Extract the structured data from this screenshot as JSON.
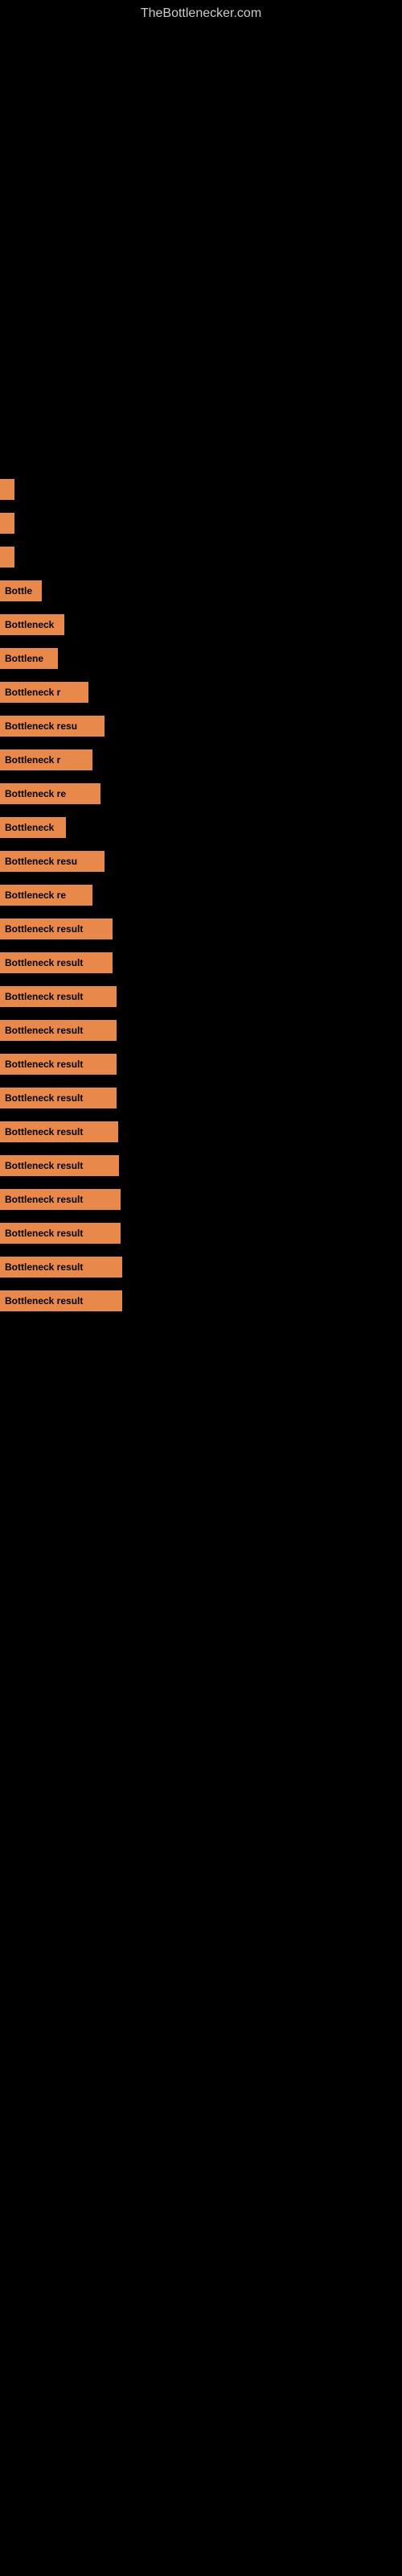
{
  "site": {
    "title": "TheBottlenecker.com"
  },
  "bars": [
    {
      "id": 1,
      "label": "",
      "width_class": "bar-1",
      "text": ""
    },
    {
      "id": 2,
      "label": "",
      "width_class": "bar-2",
      "text": ""
    },
    {
      "id": 3,
      "label": "",
      "width_class": "bar-3",
      "text": ""
    },
    {
      "id": 4,
      "label": "Bottle",
      "width_class": "bar-4",
      "text": "Bottle"
    },
    {
      "id": 5,
      "label": "Bottleneck",
      "width_class": "bar-5",
      "text": "Bottleneck"
    },
    {
      "id": 6,
      "label": "Bottlene",
      "width_class": "bar-6",
      "text": "Bottlene"
    },
    {
      "id": 7,
      "label": "Bottleneck r",
      "width_class": "bar-7",
      "text": "Bottleneck r"
    },
    {
      "id": 8,
      "label": "Bottleneck resu",
      "width_class": "bar-8",
      "text": "Bottleneck resu"
    },
    {
      "id": 9,
      "label": "Bottleneck r",
      "width_class": "bar-9",
      "text": "Bottleneck r"
    },
    {
      "id": 10,
      "label": "Bottleneck re",
      "width_class": "bar-10",
      "text": "Bottleneck re"
    },
    {
      "id": 11,
      "label": "Bottleneck",
      "width_class": "bar-11",
      "text": "Bottleneck"
    },
    {
      "id": 12,
      "label": "Bottleneck resu",
      "width_class": "bar-12",
      "text": "Bottleneck resu"
    },
    {
      "id": 13,
      "label": "Bottleneck re",
      "width_class": "bar-13",
      "text": "Bottleneck re"
    },
    {
      "id": 14,
      "label": "Bottleneck result",
      "width_class": "bar-14",
      "text": "Bottleneck result"
    },
    {
      "id": 15,
      "label": "Bottleneck result",
      "width_class": "bar-15",
      "text": "Bottleneck result"
    },
    {
      "id": 16,
      "label": "Bottleneck result",
      "width_class": "bar-16",
      "text": "Bottleneck result"
    },
    {
      "id": 17,
      "label": "Bottleneck result",
      "width_class": "bar-17",
      "text": "Bottleneck result"
    },
    {
      "id": 18,
      "label": "Bottleneck result",
      "width_class": "bar-18",
      "text": "Bottleneck result"
    },
    {
      "id": 19,
      "label": "Bottleneck result",
      "width_class": "bar-19",
      "text": "Bottleneck result"
    },
    {
      "id": 20,
      "label": "Bottleneck result",
      "width_class": "bar-20",
      "text": "Bottleneck result"
    },
    {
      "id": 21,
      "label": "Bottleneck result",
      "width_class": "bar-21",
      "text": "Bottleneck result"
    },
    {
      "id": 22,
      "label": "Bottleneck result",
      "width_class": "bar-22",
      "text": "Bottleneck result"
    },
    {
      "id": 23,
      "label": "Bottleneck result",
      "width_class": "bar-23",
      "text": "Bottleneck result"
    },
    {
      "id": 24,
      "label": "Bottleneck result",
      "width_class": "bar-24",
      "text": "Bottleneck result"
    },
    {
      "id": 25,
      "label": "Bottleneck result",
      "width_class": "bar-25",
      "text": "Bottleneck result"
    }
  ]
}
